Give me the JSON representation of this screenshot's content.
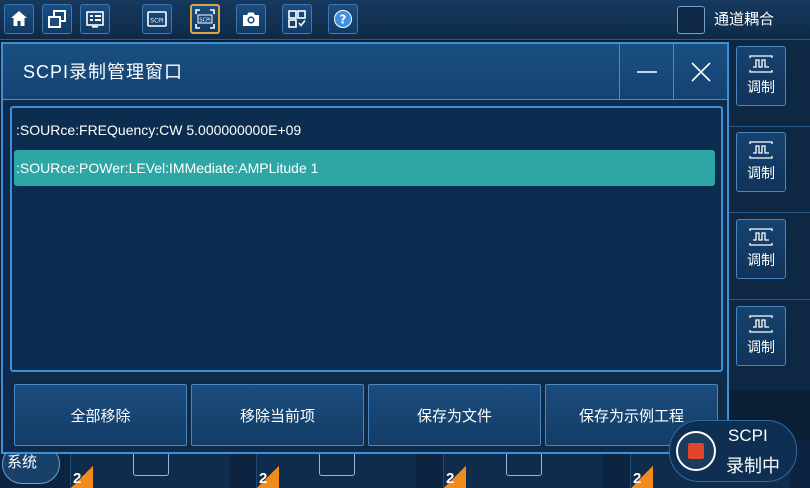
{
  "toolbar": {
    "buttons": [
      {
        "icon": "home-icon"
      },
      {
        "icon": "windows-icon"
      },
      {
        "icon": "checklist-icon"
      },
      {
        "icon": "scpi-icon"
      },
      {
        "icon": "scpi-record-icon",
        "label": "SCPI",
        "active": true
      },
      {
        "icon": "camera-icon"
      },
      {
        "icon": "grid-icon"
      },
      {
        "icon": "help-icon"
      }
    ],
    "coupling_label": "通道耦合"
  },
  "side_panel": {
    "items": [
      {
        "label": "调制",
        "icon": "modulation-icon"
      },
      {
        "label": "调制",
        "icon": "modulation-icon"
      },
      {
        "label": "调制",
        "icon": "modulation-icon"
      },
      {
        "label": "调制",
        "icon": "modulation-icon"
      }
    ]
  },
  "dialog": {
    "title": "SCPI录制管理窗口",
    "commands": [
      ":SOURce:FREQuency:CW 5.000000000E+09",
      ":SOURce:POWer:LEVel:IMMediate:AMPLitude 1"
    ],
    "selected_index": 1,
    "actions": {
      "remove_all": "全部移除",
      "remove_current": "移除当前项",
      "save_file": "保存为文件",
      "save_example": "保存为示例工程"
    }
  },
  "bottom": {
    "system_label": "系统",
    "tile_badges": [
      "2",
      "2",
      "2",
      "2"
    ]
  },
  "recording": {
    "line1": "SCPI",
    "line2": "录制中"
  },
  "colors": {
    "accent_border": "#3d8fd6",
    "selected_row": "#2fa6a6",
    "record_red": "#e0462c",
    "active_toolbar": "#d9a640"
  }
}
